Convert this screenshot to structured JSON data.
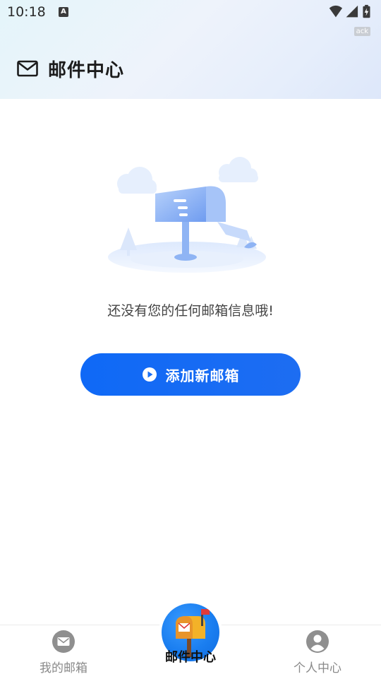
{
  "status_bar": {
    "time": "10:18",
    "a_glyph": "A",
    "ack_badge": "ack",
    "icons": [
      "wifi-icon",
      "signal-icon",
      "battery-charging-icon"
    ]
  },
  "header": {
    "title": "邮件中心",
    "icon": "mail-icon"
  },
  "empty_state": {
    "message": "还没有您的任何邮箱信息哦!",
    "illustration": "mailbox-illustration"
  },
  "add_button": {
    "label": "添加新邮箱",
    "icon": "play-circle-icon"
  },
  "tabbar": {
    "tabs": [
      {
        "label": "我的邮箱",
        "icon": "mailbox-tab-icon"
      },
      {
        "label": "邮件中心",
        "icon": "mailbox-fab-icon"
      },
      {
        "label": "个人中心",
        "icon": "profile-icon"
      }
    ]
  },
  "colors": {
    "accent": "#1a6ff3",
    "header_bg": "#e6eefb",
    "tab_inactive": "#8a8a8a"
  }
}
